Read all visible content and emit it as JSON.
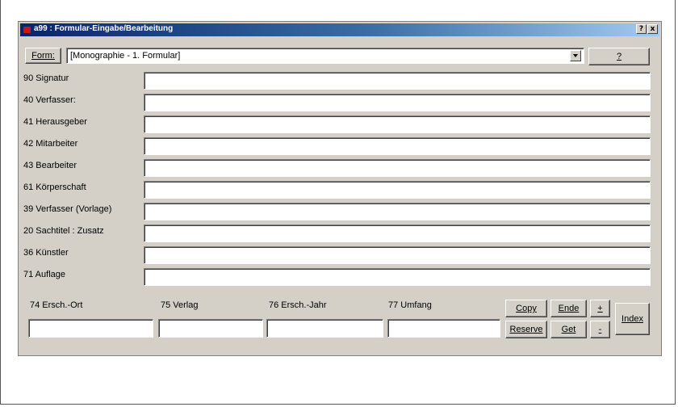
{
  "window": {
    "title": "a99 : Formular-Eingabe/Bearbeitung",
    "help_btn": "?",
    "close_btn": "x"
  },
  "form": {
    "button_label": "Form:",
    "selected": "[Monographie - 1. Formular]",
    "help_label": "?"
  },
  "fields": [
    {
      "label": "90 Signatur"
    },
    {
      "label": "40 Verfasser:"
    },
    {
      "label": "41 Herausgeber"
    },
    {
      "label": "42 Mitarbeiter"
    },
    {
      "label": "43 Bearbeiter"
    },
    {
      "label": "61 Körperschaft"
    },
    {
      "label": "39 Verfasser (Vorlage)"
    },
    {
      "label": "20 Sachtitel : Zusatz"
    },
    {
      "label": "36 Künstler"
    },
    {
      "label": "71 Auflage"
    }
  ],
  "bottom_fields": [
    {
      "label": "74 Ersch.-Ort"
    },
    {
      "label": "75 Verlag"
    },
    {
      "label": "76 Ersch.-Jahr"
    },
    {
      "label": "77 Umfang"
    }
  ],
  "buttons": {
    "copy": "Copy",
    "ende": "Ende",
    "plus": "+",
    "reserve": "Reserve",
    "get": "Get",
    "minus": "-",
    "index": "Index"
  }
}
